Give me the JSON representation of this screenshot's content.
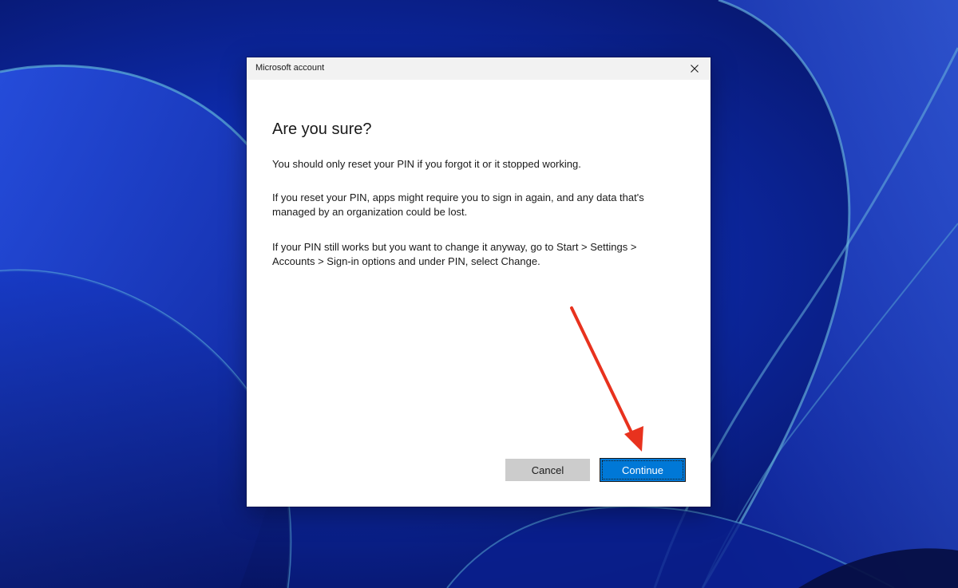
{
  "window": {
    "title": "Microsoft account"
  },
  "dialog": {
    "heading": "Are you sure?",
    "paragraphs": [
      "You should only reset your PIN if you forgot it or it stopped working.",
      "If you reset your PIN, apps might require you to sign in again, and any data that's managed by an organization could be lost.",
      "If your PIN still works but you want to change it anyway, go to Start > Settings > Accounts > Sign-in options and under PIN, select Change."
    ],
    "buttons": {
      "cancel_label": "Cancel",
      "continue_label": "Continue"
    }
  },
  "colors": {
    "accent": "#0078d7",
    "annotation_arrow": "#e8321e"
  },
  "icons": {
    "close": "close-icon",
    "annotation": "red-arrow-icon"
  }
}
